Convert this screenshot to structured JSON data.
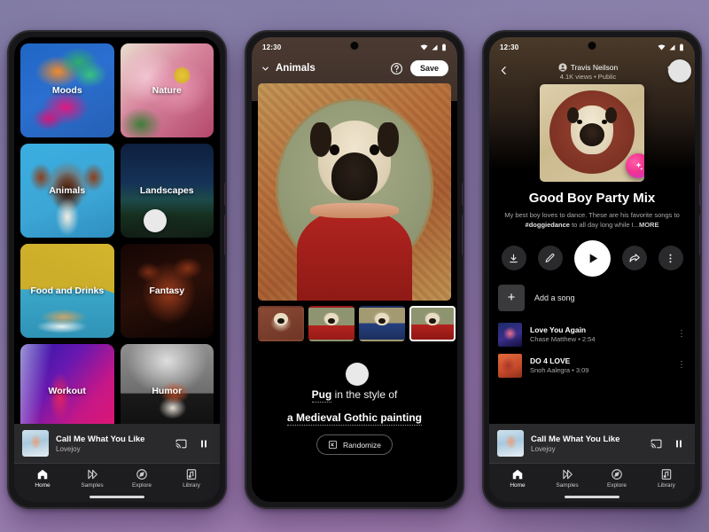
{
  "background": {
    "accent": "#9b7fb2"
  },
  "phone1": {
    "name": "explore-grid-phone",
    "tiles": [
      {
        "label": "Moods",
        "art": "art-moods"
      },
      {
        "label": "Nature",
        "art": "art-nature"
      },
      {
        "label": "Animals",
        "art": "art-animals"
      },
      {
        "label": "Landscapes",
        "art": "art-landscapes"
      },
      {
        "label": "Food and Drinks",
        "art": "art-food"
      },
      {
        "label": "Fantasy",
        "art": "art-fantasy"
      },
      {
        "label": "Workout",
        "art": "art-workout"
      },
      {
        "label": "Humor",
        "art": "art-humor"
      }
    ],
    "mini_player": {
      "title": "Call Me What You Like",
      "artist": "Lovejoy",
      "cast_icon": "cast-icon",
      "pause_icon": "pause-icon"
    },
    "nav": [
      {
        "label": "Home",
        "icon": "home-icon",
        "active": true
      },
      {
        "label": "Samples",
        "icon": "samples-icon",
        "active": false
      },
      {
        "label": "Explore",
        "icon": "explore-icon",
        "active": false
      },
      {
        "label": "Library",
        "icon": "library-icon",
        "active": false
      }
    ]
  },
  "phone2": {
    "name": "art-generator-phone",
    "status": {
      "time": "12:30",
      "wifi_icon": "wifi-icon",
      "signal_icon": "signal-icon",
      "battery_icon": "battery-icon"
    },
    "header": {
      "category": "Animals",
      "chevron_icon": "chevron-down-icon",
      "help_icon": "help-circle-icon",
      "save_label": "Save"
    },
    "thumbnails": [
      {
        "name": "variant-1",
        "selected": false,
        "art": "tbg1"
      },
      {
        "name": "variant-2",
        "selected": false,
        "art": "tbg2"
      },
      {
        "name": "variant-3",
        "selected": false,
        "art": "tbg3"
      },
      {
        "name": "variant-4",
        "selected": true,
        "art": "tbg4"
      }
    ],
    "prompt": {
      "subject": "Pug",
      "connector": " in the style of",
      "style": "a Medieval Gothic painting"
    },
    "randomize_label": "Randomize",
    "randomize_icon": "shuffle-box-icon"
  },
  "phone3": {
    "name": "playlist-phone",
    "status": {
      "time": "12:30",
      "wifi_icon": "wifi-icon",
      "signal_icon": "signal-icon",
      "battery_icon": "battery-icon"
    },
    "header": {
      "back_icon": "back-arrow-icon",
      "owner": "Travis Neilson",
      "owner_icon": "account-icon",
      "meta": "4.1K views  •  Public",
      "cast_icon": "cast-icon"
    },
    "album_badge_icon": "sparkle-icon",
    "mix_title": "Good Boy Party Mix",
    "mix_description_1": "My best boy loves to dance. These are his favorite",
    "mix_description_2a": "songs to ",
    "mix_description_hashtag": "#doggiedance",
    "mix_description_2b": " to all day long while I...",
    "mix_description_more": "MORE",
    "actions": [
      {
        "name": "download-button",
        "icon": "download-icon"
      },
      {
        "name": "edit-button",
        "icon": "pencil-icon"
      },
      {
        "name": "play-button",
        "icon": "play-icon"
      },
      {
        "name": "share-button",
        "icon": "share-icon"
      },
      {
        "name": "more-button",
        "icon": "kebab-icon"
      }
    ],
    "add_song_label": "Add a song",
    "add_song_icon": "plus-icon",
    "songs": [
      {
        "title": "Love You Again",
        "subtitle": "Chase Matthew  •  2:54",
        "art": "s1"
      },
      {
        "title": "DO 4 LOVE",
        "subtitle": "Snoh Aalegra  •  3:09",
        "art": "s2"
      }
    ],
    "mini_player": {
      "title": "Call Me What You Like",
      "artist": "Lovejoy",
      "cast_icon": "cast-icon",
      "pause_icon": "pause-icon"
    },
    "nav": [
      {
        "label": "Home",
        "icon": "home-icon",
        "active": true
      },
      {
        "label": "Samples",
        "icon": "samples-icon",
        "active": false
      },
      {
        "label": "Explore",
        "icon": "explore-icon",
        "active": false
      },
      {
        "label": "Library",
        "icon": "library-icon",
        "active": false
      }
    ]
  }
}
